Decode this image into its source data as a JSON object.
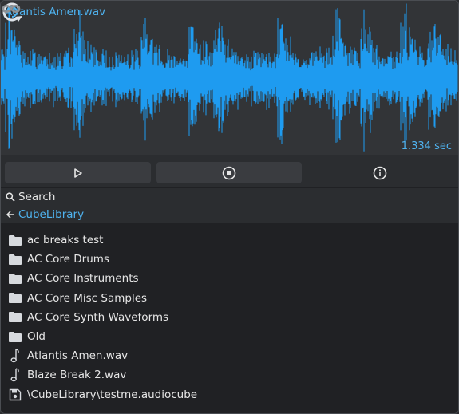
{
  "player": {
    "file_title": "Atlantis Amen.wav",
    "duration": "1.334 sec",
    "waveform_color": "#1e9bf0",
    "accent_color": "#4fb3f0"
  },
  "controls": {
    "play_icon": "play-icon",
    "stop_icon": "stop-icon",
    "info_icon": "info-icon"
  },
  "browser": {
    "search_label": "Search",
    "breadcrumb": "CubeLibrary",
    "items": [
      {
        "label": "ac breaks test",
        "icon": "folder-icon"
      },
      {
        "label": "AC Core Drums",
        "icon": "folder-icon"
      },
      {
        "label": "AC Core Instruments",
        "icon": "folder-icon"
      },
      {
        "label": "AC Core Misc Samples",
        "icon": "folder-icon"
      },
      {
        "label": "AC Core Synth Waveforms",
        "icon": "folder-icon"
      },
      {
        "label": "Old",
        "icon": "folder-icon"
      },
      {
        "label": "Atlantis Amen.wav",
        "icon": "music-note-icon"
      },
      {
        "label": "Blaze Break 2.wav",
        "icon": "music-note-icon"
      },
      {
        "label": "\\CubeLibrary\\testme.audiocube",
        "icon": "save-disk-icon"
      }
    ]
  }
}
